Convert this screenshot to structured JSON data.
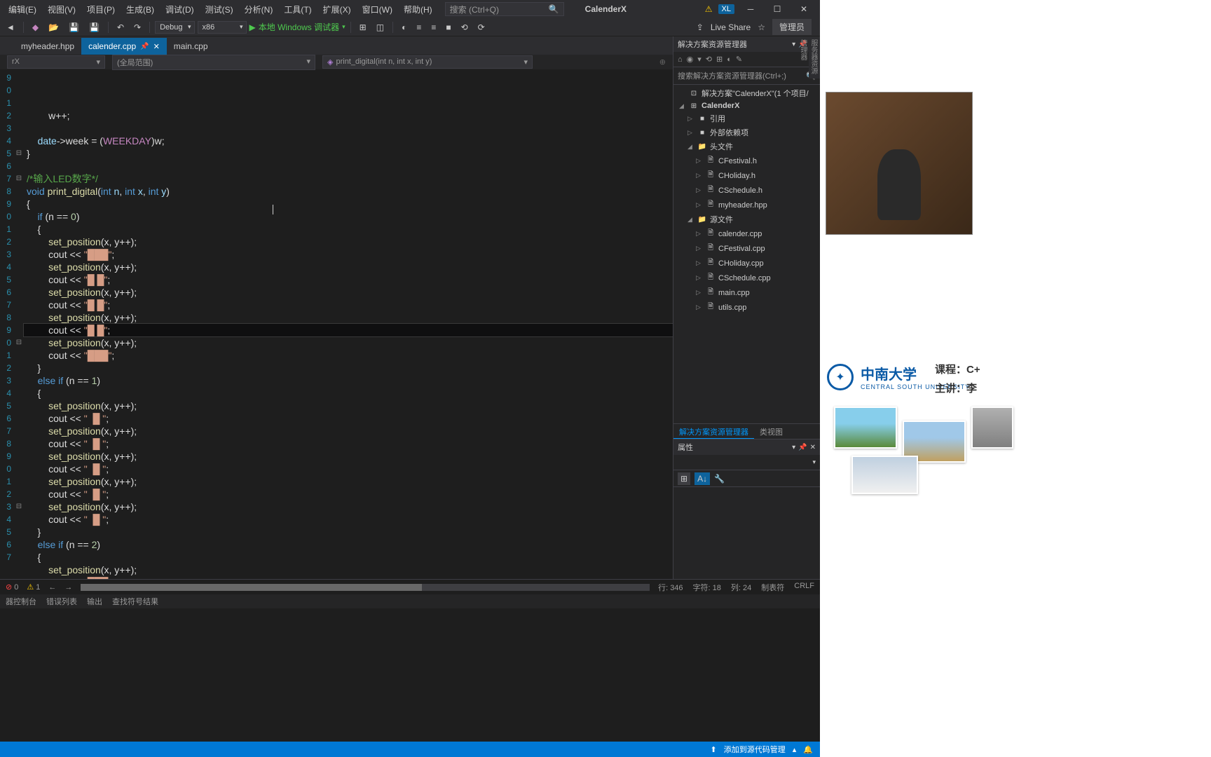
{
  "menu": [
    "编辑(E)",
    "视图(V)",
    "项目(P)",
    "生成(B)",
    "调试(D)",
    "测试(S)",
    "分析(N)",
    "工具(T)",
    "扩展(X)",
    "窗口(W)",
    "帮助(H)"
  ],
  "search_placeholder": "搜索 (Ctrl+Q)",
  "app_title": "CalenderX",
  "user_badge": "XL",
  "toolbar": {
    "config": "Debug",
    "platform": "x86",
    "debugger": "本地 Windows 调试器",
    "live_share": "Live Share",
    "admin": "管理员"
  },
  "tabs": [
    {
      "label": "myheader.hpp",
      "active": false
    },
    {
      "label": "calender.cpp",
      "active": true
    },
    {
      "label": "main.cpp",
      "active": false
    }
  ],
  "breadcrumb": {
    "scope1": "rX",
    "scope2": "(全局范围)",
    "func": "print_digital(int n, int x, int y)"
  },
  "code_lines": [
    {
      "n": "9",
      "html": "        w++;"
    },
    {
      "n": "0",
      "html": ""
    },
    {
      "n": "1",
      "html": "    <span class='k-param'>date</span>-&gt;week = (<span class='k-macro'>WEEKDAY</span>)w;"
    },
    {
      "n": "2",
      "html": "}"
    },
    {
      "n": "3",
      "html": ""
    },
    {
      "n": "4",
      "html": "<span class='k-green'>/*输入LED数字*/</span>"
    },
    {
      "n": "5",
      "html": "<span class='k-blue'>void</span> <span class='k-func'>print_digital</span>(<span class='k-blue'>int</span> <span class='k-param'>n</span>, <span class='k-blue'>int</span> <span class='k-param'>x</span>, <span class='k-blue'>int</span> <span class='k-param'>y</span>)",
      "fold": "⊟"
    },
    {
      "n": "6",
      "html": "{"
    },
    {
      "n": "7",
      "html": "    <span class='k-blue'>if</span> (n == <span class='k-num'>0</span>)",
      "fold": "⊟"
    },
    {
      "n": "8",
      "html": "    {"
    },
    {
      "n": "9",
      "html": "        <span class='k-func'>set_position</span>(x, y++);"
    },
    {
      "n": "0",
      "html": "        cout &lt;&lt; <span class='k-str'>\"███\"</span>;"
    },
    {
      "n": "1",
      "html": "        <span class='k-func'>set_position</span>(x, y++);"
    },
    {
      "n": "2",
      "html": "        cout &lt;&lt; <span class='k-str'>\"█ █\"</span>;"
    },
    {
      "n": "3",
      "html": "        <span class='k-func'>set_position</span>(x, y++);"
    },
    {
      "n": "4",
      "html": "        cout &lt;&lt; <span class='k-str'>\"█ █\"</span>;"
    },
    {
      "n": "5",
      "html": "        <span class='k-func'>set_position</span>(x, y++);"
    },
    {
      "n": "6",
      "html": "        cout &lt;&lt; <span class='k-str'>\"█ █\"</span>;",
      "current": true
    },
    {
      "n": "7",
      "html": "        <span class='k-func'>set_position</span>(x, y++);"
    },
    {
      "n": "8",
      "html": "        cout &lt;&lt; <span class='k-str'>\"███\"</span>;"
    },
    {
      "n": "9",
      "html": "    }"
    },
    {
      "n": "0",
      "html": "    <span class='k-blue'>else if</span> (n == <span class='k-num'>1</span>)",
      "fold": "⊟"
    },
    {
      "n": "1",
      "html": "    {"
    },
    {
      "n": "2",
      "html": "        <span class='k-func'>set_position</span>(x, y++);"
    },
    {
      "n": "3",
      "html": "        cout &lt;&lt; <span class='k-str'>\"  █ \"</span>;"
    },
    {
      "n": "4",
      "html": "        <span class='k-func'>set_position</span>(x, y++);"
    },
    {
      "n": "5",
      "html": "        cout &lt;&lt; <span class='k-str'>\"  █ \"</span>;"
    },
    {
      "n": "6",
      "html": "        <span class='k-func'>set_position</span>(x, y++);"
    },
    {
      "n": "7",
      "html": "        cout &lt;&lt; <span class='k-str'>\"  █ \"</span>;"
    },
    {
      "n": "8",
      "html": "        <span class='k-func'>set_position</span>(x, y++);"
    },
    {
      "n": "9",
      "html": "        cout &lt;&lt; <span class='k-str'>\"  █ \"</span>;"
    },
    {
      "n": "0",
      "html": "        <span class='k-func'>set_position</span>(x, y++);"
    },
    {
      "n": "1",
      "html": "        cout &lt;&lt; <span class='k-str'>\"  █ \"</span>;"
    },
    {
      "n": "2",
      "html": "    }"
    },
    {
      "n": "3",
      "html": "    <span class='k-blue'>else if</span> (n == <span class='k-num'>2</span>)",
      "fold": "⊟"
    },
    {
      "n": "4",
      "html": "    {"
    },
    {
      "n": "5",
      "html": "        <span class='k-func'>set_position</span>(x, y++);"
    },
    {
      "n": "6",
      "html": "        cout &lt;&lt; <span class='k-str'>\"███\"</span>;"
    },
    {
      "n": "7",
      "html": "        <span class='k-func'>set_position</span>(x, y++);"
    }
  ],
  "solution_explorer": {
    "title": "解决方案资源管理器",
    "search": "搜索解决方案资源管理器(Ctrl+;)",
    "root": "解决方案\"CalenderX\"(1 个项目/",
    "project": "CalenderX",
    "folders": {
      "refs": "引用",
      "external": "外部依赖项",
      "headers": "头文件",
      "sources": "源文件"
    },
    "header_files": [
      "CFestival.h",
      "CHoliday.h",
      "CSchedule.h",
      "myheader.hpp"
    ],
    "source_files": [
      "calender.cpp",
      "CFestival.cpp",
      "CHoliday.cpp",
      "CSchedule.cpp",
      "main.cpp",
      "utils.cpp"
    ],
    "tabs": [
      "解决方案资源管理器",
      "类视图"
    ]
  },
  "properties": {
    "title": "属性"
  },
  "status": {
    "errors": "0",
    "warnings": "1",
    "line": "行: 346",
    "char": "字符: 18",
    "col": "列: 24",
    "ins": "制表符",
    "crlf": "CRLF"
  },
  "bottom_tabs": [
    "器控制台",
    "错误列表",
    "输出",
    "查找符号结果"
  ],
  "taskbar": {
    "source_control": "添加到源代码管理"
  },
  "university": {
    "name": "中南大学",
    "sub": "CENTRAL SOUTH UNIVERSITY",
    "course": "课程：C+",
    "lecturer": "主讲：李"
  },
  "vert_tab": "服务器资源管理器"
}
